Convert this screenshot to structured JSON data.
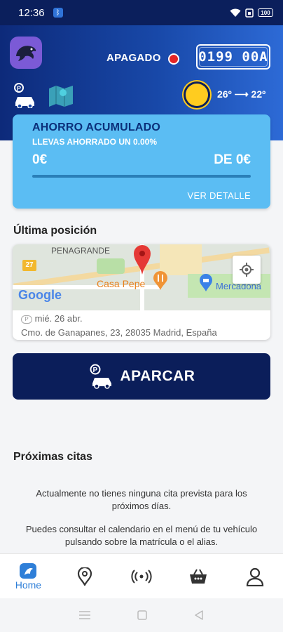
{
  "status_bar": {
    "time": "12:36",
    "battery": "100"
  },
  "header": {
    "engine_status": "APAGADO",
    "plate": "0199 00A",
    "temperature": "26º ⟶ 22º",
    "colors": {
      "bg_start": "#0d2a7a",
      "bg_end": "#2d6ad6",
      "engine_dot": "#e52525",
      "sun": "#ffcc1f"
    }
  },
  "savings": {
    "title": "AHORRO ACUMULADO",
    "subtitle": "LLEVAS AHORRADO UN 0.00%",
    "amount": "0€",
    "goal": "DE 0€",
    "progress": 0,
    "detail_link": "VER DETALLE"
  },
  "last_position": {
    "title": "Última posición",
    "map_labels": {
      "area": "PENAGRANDE",
      "road": "27",
      "poi1": "Casa Pepe",
      "poi2": "Mercadona",
      "brand": "Google"
    },
    "date": "mié. 26 abr.",
    "address": "Cmo. de Ganapanes, 23, 28035 Madrid, España"
  },
  "park_button": "APARCAR",
  "appointments": {
    "title": "Próximas citas",
    "empty_line1": "Actualmente no tienes ninguna cita prevista para los próximos días.",
    "empty_line2": "Puedes consultar el calendario en el menú de tu vehículo pulsando sobre la matrícula o el alias."
  },
  "bottom_nav": {
    "home_label": "Home",
    "active_color": "#2f7fd8"
  }
}
